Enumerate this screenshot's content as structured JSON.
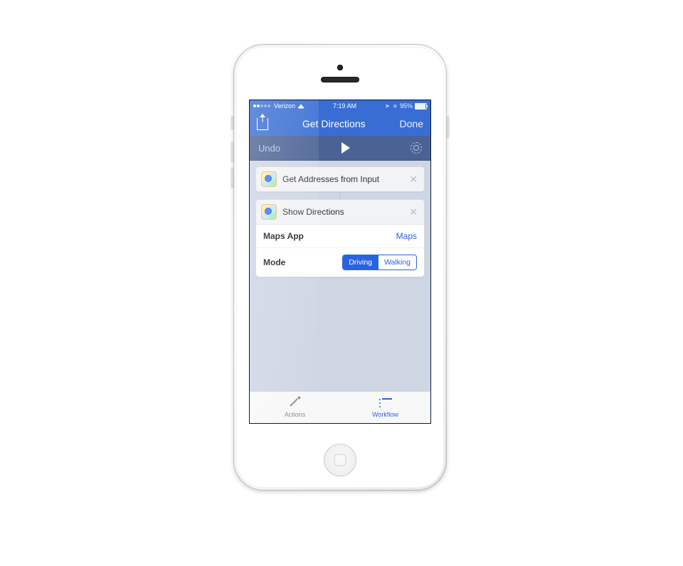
{
  "status": {
    "carrier": "Verizon",
    "time": "7:19 AM",
    "battery": "95%"
  },
  "nav": {
    "title": "Get Directions",
    "done": "Done"
  },
  "toolbar": {
    "undo": "Undo"
  },
  "actions": [
    {
      "title": "Get Addresses from Input"
    },
    {
      "title": "Show Directions",
      "rows": {
        "maps_app": {
          "label": "Maps App",
          "value": "Maps"
        },
        "mode": {
          "label": "Mode",
          "options": [
            "Driving",
            "Walking"
          ],
          "selected": "Driving"
        }
      }
    }
  ],
  "tabs": {
    "actions": "Actions",
    "workflow": "Workflow"
  }
}
